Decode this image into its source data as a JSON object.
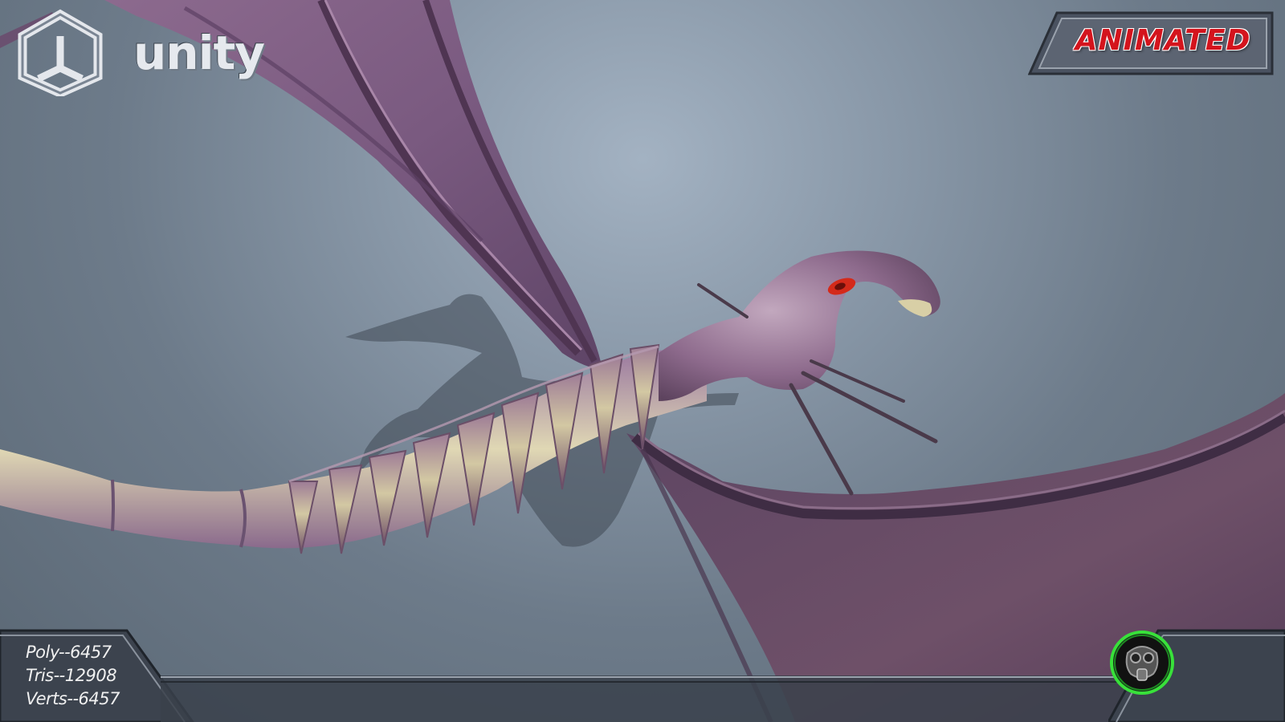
{
  "branding": {
    "engine_name": "unity",
    "engine_logo_icon": "unity-cube-icon"
  },
  "badge": {
    "label": "ANIMATED",
    "color": "#d4141d"
  },
  "stats": {
    "poly": "Poly--6457",
    "tris": "Tris--12908",
    "verts": "Verts--6457"
  },
  "emblem": {
    "icon": "gas-mask-icon",
    "glow_color": "#38e13a"
  },
  "scene": {
    "subject": "flying-dragon-creature",
    "accent_colors": {
      "wing": "#6b4a6e",
      "body_light": "#d8cfa6",
      "body_dark": "#7a4a6c",
      "eye": "#d42a1a",
      "background": "#8796a6"
    }
  }
}
